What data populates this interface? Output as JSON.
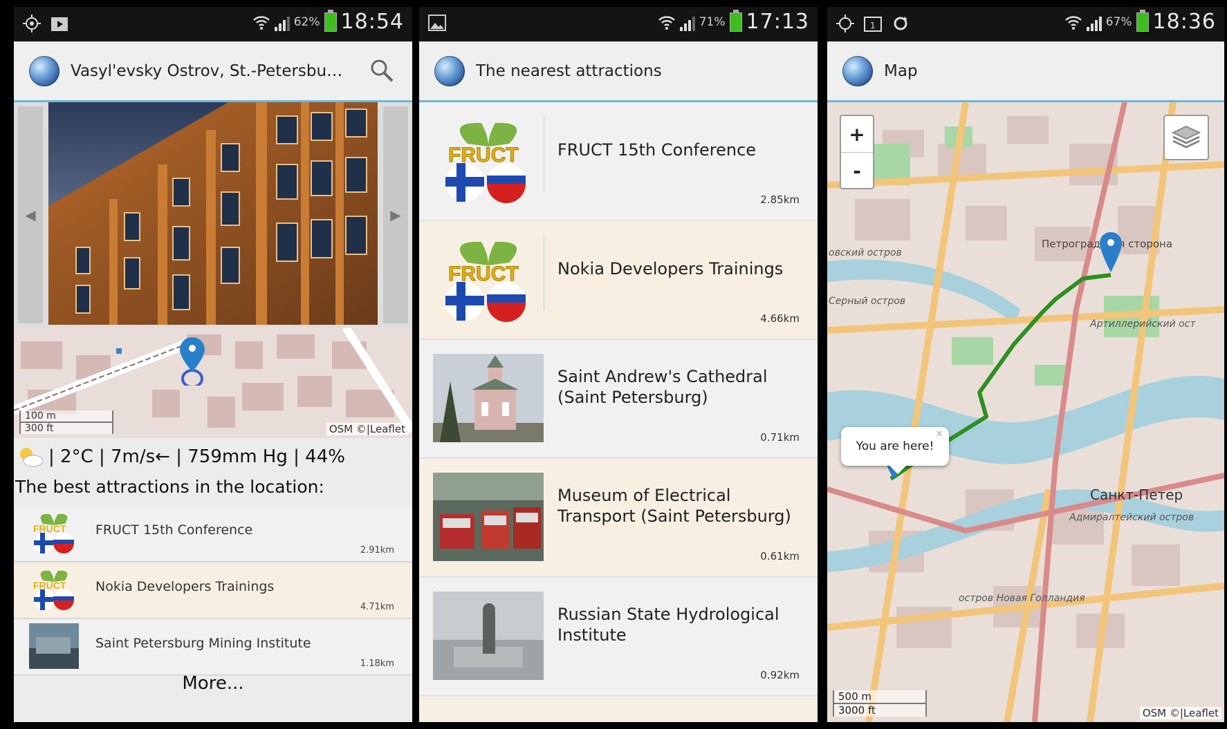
{
  "screen1": {
    "status": {
      "battery": "62%",
      "time": "18:54"
    },
    "title": "Vasyl'evsky Ostrov, St.-Petersburg,...",
    "map": {
      "scale_m": "100 m",
      "scale_ft": "300 ft",
      "attribution": "OSM ©|Leaflet"
    },
    "weather": {
      "icon": "partly-cloudy-icon",
      "text": "| 2°C | 7m/s← | 759mm Hg | 44%"
    },
    "best_title": "The best attractions in the location:",
    "items": [
      {
        "name": "FRUCT 15th Conference",
        "dist": "2.91km",
        "thumb": "fruct-logo"
      },
      {
        "name": "Nokia Developers Trainings",
        "dist": "4.71km",
        "thumb": "fruct-logo"
      },
      {
        "name": "Saint Petersburg Mining Institute",
        "dist": "1.18km",
        "thumb": "photo"
      }
    ],
    "more": "More..."
  },
  "screen2": {
    "status": {
      "battery": "71%",
      "time": "17:13"
    },
    "title": "The nearest attractions",
    "items": [
      {
        "name": "FRUCT 15th Conference",
        "dist": "2.85km"
      },
      {
        "name": "Nokia Developers Trainings",
        "dist": "4.66km"
      },
      {
        "name": "Saint Andrew's Cathedral (Saint Petersburg)",
        "dist": "0.71km"
      },
      {
        "name": "Museum of Electrical Transport (Saint Petersburg)",
        "dist": "0.61km"
      },
      {
        "name": "Russian State Hydrological Institute",
        "dist": "0.92km"
      }
    ]
  },
  "screen3": {
    "status": {
      "battery": "67%",
      "time": "18:36"
    },
    "title": "Map",
    "zoom_in": "+",
    "zoom_out": "-",
    "popup": "You are here!",
    "scale_m": "500 m",
    "scale_ft": "3000 ft",
    "attribution": "OSM ©|Leaflet",
    "colors": {
      "route": "#2e8f22",
      "marker": "#2a7fc9",
      "accent": "#6cb6d9"
    }
  }
}
